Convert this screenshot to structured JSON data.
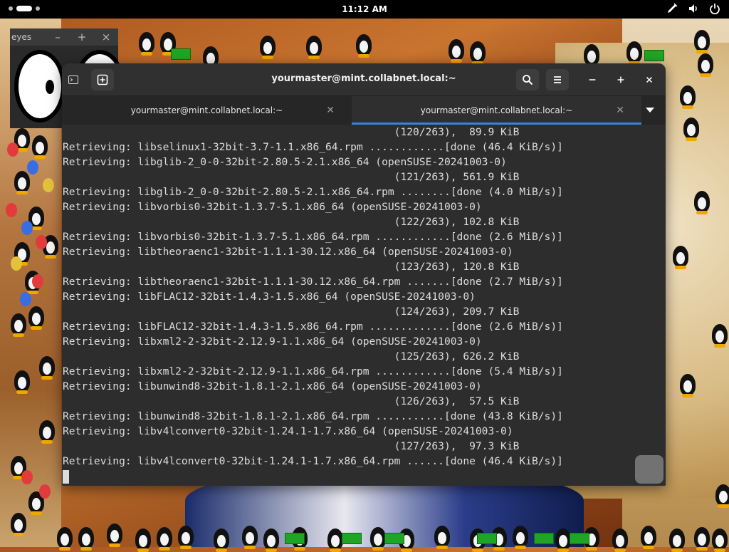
{
  "topbar": {
    "clock": "11:12 AM"
  },
  "eyes_window": {
    "title": "eyes",
    "buttons": [
      "–",
      "+",
      "×"
    ]
  },
  "terminal": {
    "title": "yourmaster@mint.collabnet.local:~",
    "tabs": [
      {
        "label": "yourmaster@mint.collabnet.local:~",
        "active": false
      },
      {
        "label": "yourmaster@mint.collabnet.local:~",
        "active": true
      }
    ],
    "lines": [
      "                                                     (120/263),  89.9 KiB",
      "Retrieving: libselinux1-32bit-3.7-1.1.x86_64.rpm ............[done (46.4 KiB/s)]",
      "Retrieving: libglib-2_0-0-32bit-2.80.5-2.1.x86_64 (openSUSE-20241003-0)",
      "                                                     (121/263), 561.9 KiB",
      "Retrieving: libglib-2_0-0-32bit-2.80.5-2.1.x86_64.rpm ........[done (4.0 MiB/s)]",
      "Retrieving: libvorbis0-32bit-1.3.7-5.1.x86_64 (openSUSE-20241003-0)",
      "                                                     (122/263), 102.8 KiB",
      "Retrieving: libvorbis0-32bit-1.3.7-5.1.x86_64.rpm ............[done (2.6 MiB/s)]",
      "Retrieving: libtheoraenc1-32bit-1.1.1-30.12.x86_64 (openSUSE-20241003-0)",
      "                                                     (123/263), 120.8 KiB",
      "Retrieving: libtheoraenc1-32bit-1.1.1-30.12.x86_64.rpm .......[done (2.7 MiB/s)]",
      "Retrieving: libFLAC12-32bit-1.4.3-1.5.x86_64 (openSUSE-20241003-0)",
      "                                                     (124/263), 209.7 KiB",
      "Retrieving: libFLAC12-32bit-1.4.3-1.5.x86_64.rpm .............[done (2.6 MiB/s)]",
      "Retrieving: libxml2-2-32bit-2.12.9-1.1.x86_64 (openSUSE-20241003-0)",
      "                                                     (125/263), 626.2 KiB",
      "Retrieving: libxml2-2-32bit-2.12.9-1.1.x86_64.rpm ............[done (5.4 MiB/s)]",
      "Retrieving: libunwind8-32bit-1.8.1-2.1.x86_64 (openSUSE-20241003-0)",
      "                                                     (126/263),  57.5 KiB",
      "Retrieving: libunwind8-32bit-1.8.1-2.1.x86_64.rpm ...........[done (43.8 KiB/s)]",
      "Retrieving: libv4lconvert0-32bit-1.24.1-1.7.x86_64 (openSUSE-20241003-0)",
      "                                                     (127/263),  97.3 KiB",
      "Retrieving: libv4lconvert0-32bit-1.24.1-1.7.x86_64.rpm ......[done (46.4 KiB/s)]"
    ]
  },
  "icons": {
    "topbar": [
      "activities-icon",
      "pen-icon",
      "volume-icon",
      "power-icon"
    ],
    "terminal_header": [
      "terminal-icon",
      "new-tab-icon",
      "search-icon",
      "hamburger-menu-icon",
      "minimize-icon",
      "maximize-icon",
      "close-icon"
    ]
  },
  "colors": {
    "accent": "#3584e4",
    "terminal_bg": "#2d2d2d",
    "terminal_fg": "#dddddd"
  }
}
